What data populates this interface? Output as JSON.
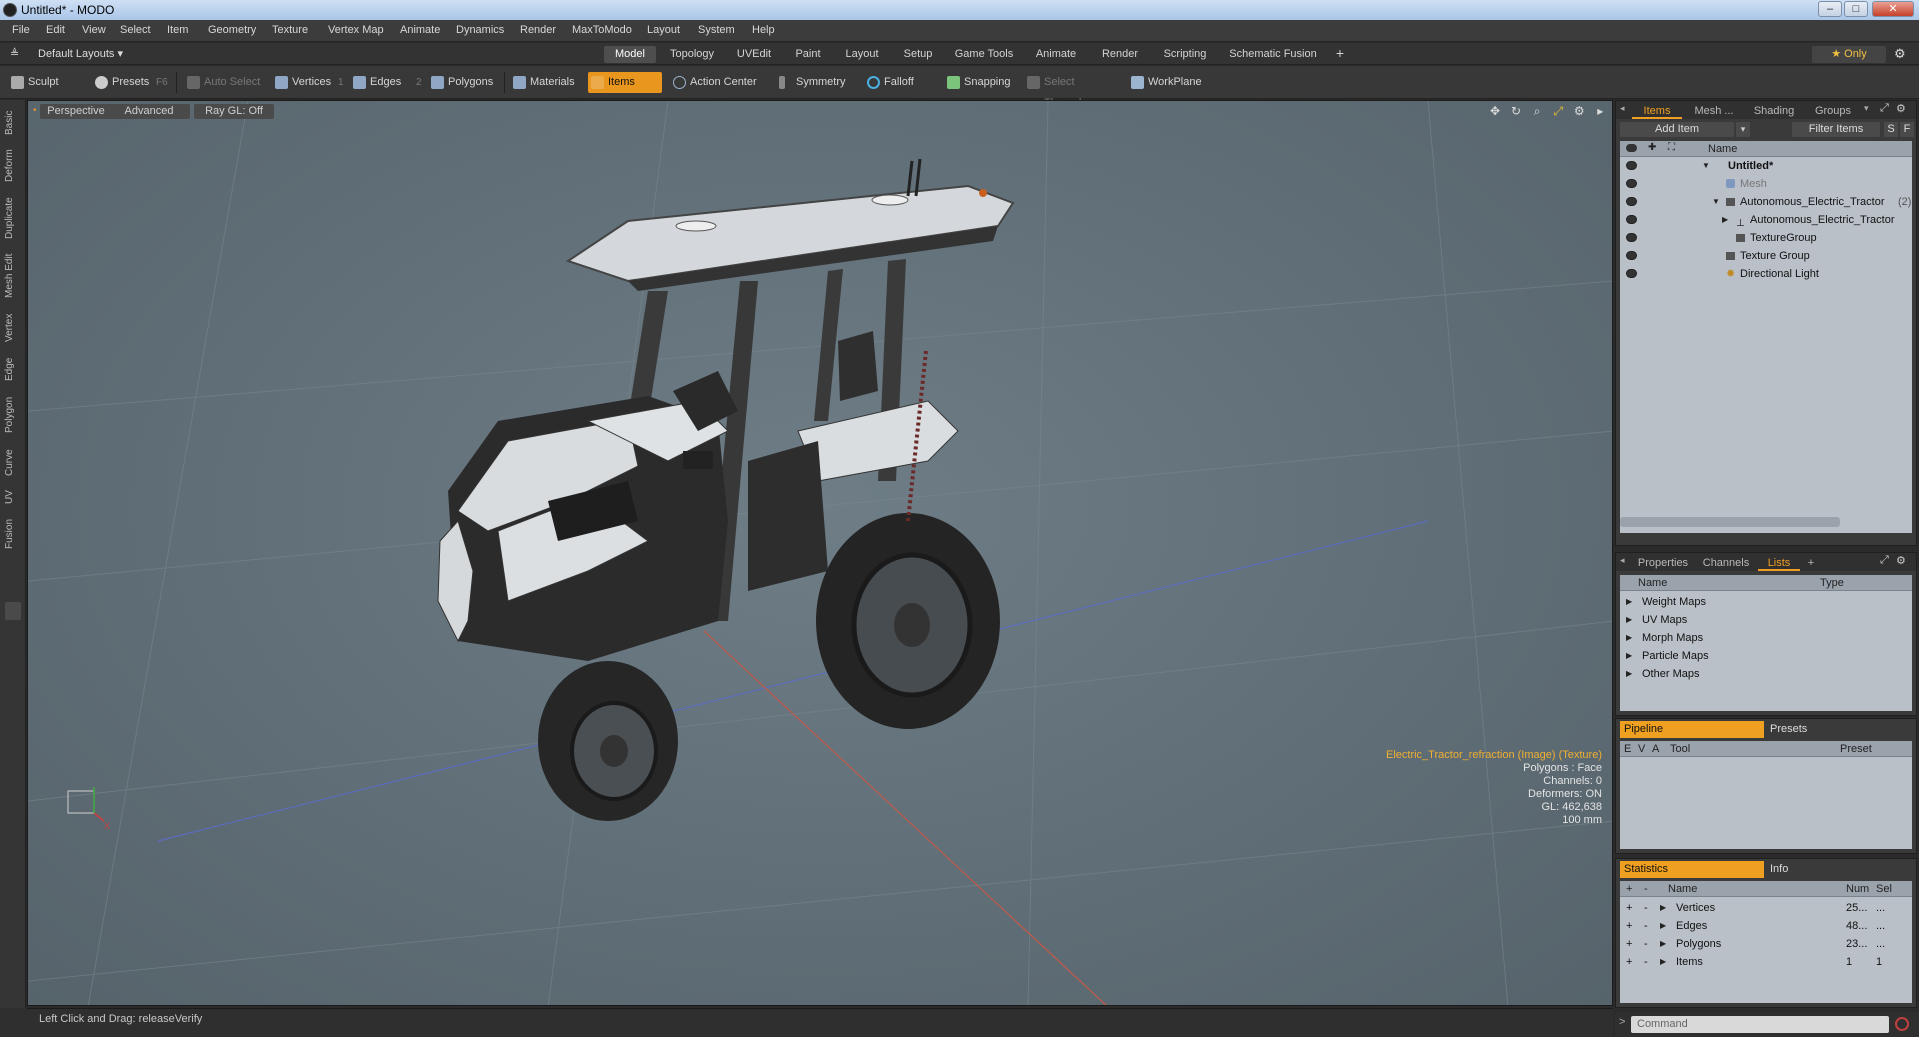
{
  "window": {
    "title": "Untitled* - MODO"
  },
  "menu": [
    "File",
    "Edit",
    "View",
    "Select",
    "Item",
    "Geometry",
    "Texture",
    "Vertex Map",
    "Animate",
    "Dynamics",
    "Render",
    "MaxToModo",
    "Layout",
    "System",
    "Help"
  ],
  "layout": {
    "selector": "Default Layouts ▾",
    "tabs": [
      "Model",
      "Topology",
      "UVEdit",
      "Paint",
      "Layout",
      "Setup",
      "Game Tools",
      "Animate",
      "Render",
      "Scripting",
      "Schematic Fusion"
    ],
    "active_tab": "Model",
    "add_tab": "+",
    "only_label": "★ Only"
  },
  "toolbar": {
    "sculpt": "Sculpt",
    "presets": "Presets",
    "presets_key": "F6",
    "auto_select": "Auto Select",
    "vertices": "Vertices",
    "vertices_key": "1",
    "edges": "Edges",
    "edges_key": "2",
    "polygons": "Polygons",
    "materials": "Materials",
    "items": "Items",
    "action_center": "Action Center",
    "symmetry": "Symmetry",
    "falloff": "Falloff",
    "snapping": "Snapping",
    "select_through": "Select Through",
    "workplane": "WorkPlane"
  },
  "left_tabs": [
    "Basic",
    "Deform",
    "Duplicate",
    "Mesh Edit",
    "Vertex",
    "Edge",
    "Polygon",
    "Curve",
    "UV",
    "Fusion"
  ],
  "viewport": {
    "view": "Perspective",
    "shading": "Advanced",
    "raygl": "Ray GL: Off",
    "info": {
      "texture": "Electric_Tractor_refraction (Image) (Texture)",
      "polygons": "Polygons : Face",
      "channels": "Channels: 0",
      "deformers": "Deformers: ON",
      "gl": "GL: 462,638",
      "scale": "100 mm"
    },
    "axis_x": "X"
  },
  "status": {
    "text": "Left Click and Drag:   releaseVerify"
  },
  "items_panel": {
    "tabs": [
      "Items",
      "Mesh ...",
      "Shading",
      "Groups"
    ],
    "add_item": "Add Item",
    "filter": "Filter Items",
    "s_btn": "S",
    "f_btn": "F",
    "col_name": "Name",
    "rows": [
      {
        "label": "Untitled*",
        "indent": 0
      },
      {
        "label": "Mesh",
        "indent": 1
      },
      {
        "label": "Autonomous_Electric_Tractor",
        "suffix": "(2)",
        "indent": 1
      },
      {
        "label": "Autonomous_Electric_Tractor",
        "indent": 2
      },
      {
        "label": "TextureGroup",
        "indent": 2
      },
      {
        "label": "Texture Group",
        "indent": 1
      },
      {
        "label": "Directional Light",
        "indent": 1
      }
    ]
  },
  "lists_panel": {
    "tabs": [
      "Properties",
      "Channels",
      "Lists"
    ],
    "add_tab": "+",
    "col_name": "Name",
    "col_type": "Type",
    "rows": [
      "Weight Maps",
      "UV Maps",
      "Morph Maps",
      "Particle Maps",
      "Other Maps"
    ]
  },
  "pipeline_panel": {
    "tabs": [
      "Pipeline",
      "Presets"
    ],
    "cols": [
      "E",
      "V",
      "A",
      "Tool",
      "Preset"
    ]
  },
  "stats_panel": {
    "tabs": [
      "Statistics",
      "Info"
    ],
    "cols": [
      "+",
      "-",
      "Name",
      "Num",
      "Sel"
    ],
    "rows": [
      {
        "name": "Vertices",
        "num": "25...",
        "sel": "..."
      },
      {
        "name": "Edges",
        "num": "48...",
        "sel": "..."
      },
      {
        "name": "Polygons",
        "num": "23...",
        "sel": "..."
      },
      {
        "name": "Items",
        "num": "1",
        "sel": "1"
      }
    ]
  },
  "command": {
    "placeholder": "Command"
  },
  "colors": {
    "accent": "#f0a020",
    "viewport": "#66747d"
  }
}
